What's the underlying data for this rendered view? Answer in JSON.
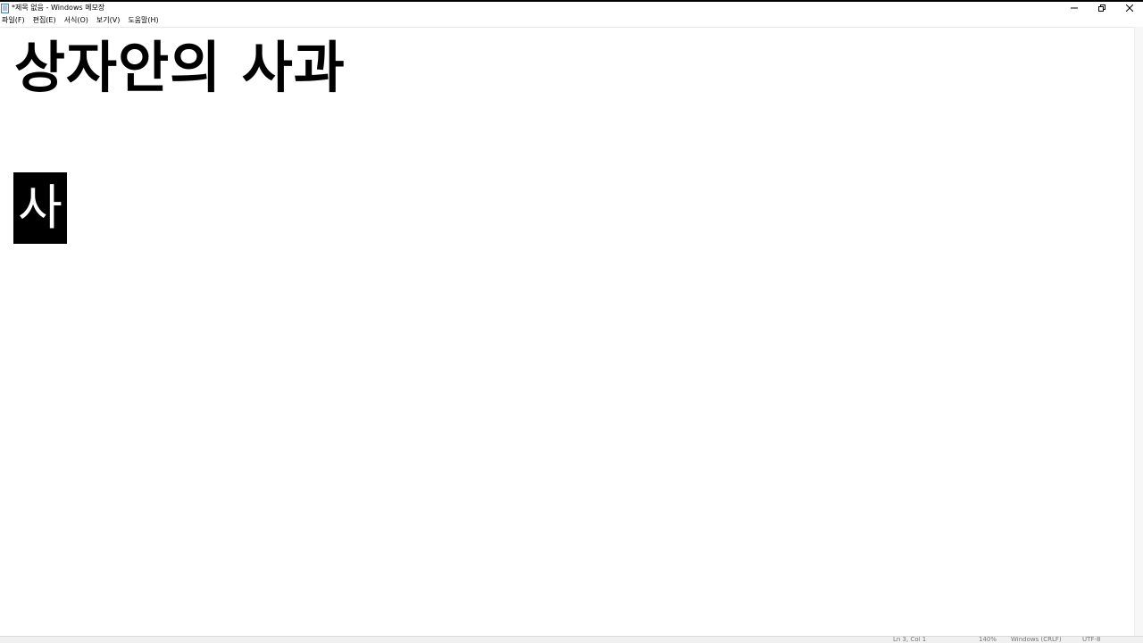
{
  "window": {
    "title": "*제목 없음 - Windows 메모장",
    "icon": "notepad-icon",
    "controls": [
      "minimize-icon",
      "restore-icon",
      "close-icon"
    ]
  },
  "menu": [
    {
      "label": "파일(F)"
    },
    {
      "label": "편집(E)"
    },
    {
      "label": "서식(O)"
    },
    {
      "label": "보기(V)"
    },
    {
      "label": "도움말(H)"
    }
  ],
  "editor": {
    "line1": "상자안의 사과",
    "line2_selected": "사"
  },
  "status": {
    "position": "Ln 3, Col 1",
    "zoom": "140%",
    "line_ending": "Windows (CRLF)",
    "encoding": "UTF-8"
  },
  "colors": {
    "selection": "#000000",
    "selection_text": "#ffffff"
  }
}
